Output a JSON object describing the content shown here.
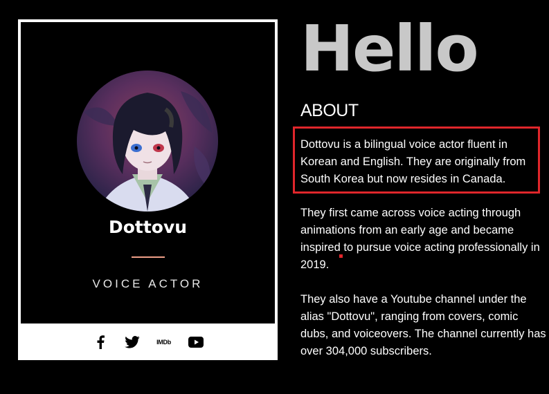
{
  "hero": {
    "title": "Hello"
  },
  "profile": {
    "name": "Dottovu",
    "role": "VOICE ACTOR",
    "avatar_alt": "anime-character-portrait",
    "accent_color": "#f0a089"
  },
  "social": {
    "imdb_label": "IMDb",
    "icons": [
      "facebook-icon",
      "twitter-icon",
      "imdb-icon",
      "youtube-icon"
    ]
  },
  "about": {
    "heading": "ABOUT",
    "paragraphs": [
      "Dottovu is a bilingual voice actor fluent in\nKorean and English. They are originally from\nSouth Korea but now resides in Canada.",
      "They first came across voice acting through\nanimations from an early age and became\ninspired to pursue voice acting professionally in\n2019.",
      "They also have a Youtube channel under the\nalias \"Dottovu\", ranging from covers, comic\ndubs, and voiceovers. The channel currently has\nover 304,000 subscribers."
    ],
    "highlight_color": "#e0262b"
  }
}
